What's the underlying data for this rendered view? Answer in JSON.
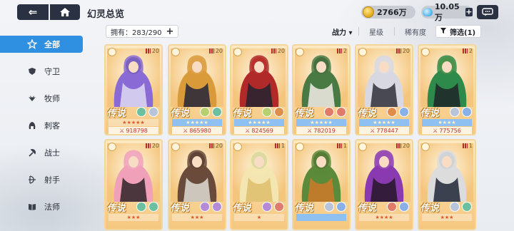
{
  "header": {
    "back_glyph": "⇐",
    "home_icon": "home-icon",
    "title": "幻灵总览",
    "gold": "2766万",
    "gems": "10.05万",
    "plus": "+"
  },
  "sidebar": {
    "items": [
      {
        "label": "全部",
        "icon": "star-icon",
        "active": true
      },
      {
        "label": "守卫",
        "icon": "shield-icon"
      },
      {
        "label": "牧师",
        "icon": "wing-icon"
      },
      {
        "label": "刺客",
        "icon": "hood-icon"
      },
      {
        "label": "战士",
        "icon": "axe-icon"
      },
      {
        "label": "射手",
        "icon": "bow-icon"
      },
      {
        "label": "法师",
        "icon": "book-icon"
      }
    ]
  },
  "filterbar": {
    "owned_label": "拥有：283/290",
    "plus": "+",
    "sort_power": "战力",
    "sort_star": "星级",
    "sort_rarity": "稀有度",
    "filter_label": "筛选(1)"
  },
  "cards": [
    {
      "level": "20",
      "rarity": "传说",
      "power": "918798",
      "stars": "★★★★★",
      "band": "none",
      "faction": [
        "#6cc0a0",
        "#b8c4d8"
      ],
      "palette": [
        "#8a6bd6",
        "#d9d4f2",
        "#303048"
      ]
    },
    {
      "level": "20",
      "rarity": "传说",
      "power": "865980",
      "stars": "★★★★★",
      "band": "blue",
      "faction": [
        "#b8d070",
        "#6cc0a0"
      ],
      "palette": [
        "#d99a3a",
        "#2d2b3a",
        "#f4d6a6"
      ]
    },
    {
      "level": "20",
      "rarity": "传说",
      "power": "824569",
      "stars": "★★★★★",
      "band": "blue",
      "faction": [
        "#b8d070",
        "#e08c4a"
      ],
      "palette": [
        "#b02a2a",
        "#2a2430",
        "#e55a3a"
      ]
    },
    {
      "level": "2",
      "rarity": "传说",
      "power": "782019",
      "stars": "★★★★★",
      "band": "blue",
      "faction": [
        "#e07a6a",
        "#e07a6a"
      ],
      "palette": [
        "#4a7a44",
        "#e9e6de",
        "#2f3a28"
      ]
    },
    {
      "level": "20",
      "rarity": "传说",
      "power": "778447",
      "stars": "★★★★★",
      "band": "blue",
      "faction": [
        "#e08c4a",
        "#8ab0e8"
      ],
      "palette": [
        "#d8d8e2",
        "#3a3a44",
        "#f0e6dc"
      ]
    },
    {
      "level": "2",
      "rarity": "传说",
      "power": "775756",
      "stars": "★★★★",
      "band": "blue",
      "faction": [
        "#b8c4d8",
        "#8ab0e8"
      ],
      "palette": [
        "#2e8a4a",
        "#1f2a2a",
        "#f6c44a"
      ]
    },
    {
      "level": "20",
      "rarity": "传说",
      "power": "",
      "stars": "★★★",
      "band": "none",
      "faction": [
        "#6cc0a0",
        "#6cc0a0"
      ],
      "palette": [
        "#f0a0b8",
        "#3a2a30",
        "#f8e0e8"
      ]
    },
    {
      "level": "20",
      "rarity": "传说",
      "power": "",
      "stars": "★★★",
      "band": "none",
      "faction": [
        "#b58ad6",
        "#b58ad6"
      ],
      "palette": [
        "#6a4a3a",
        "#d8d4cc",
        "#2a2220"
      ]
    },
    {
      "level": "1",
      "rarity": "传说",
      "power": "",
      "stars": "★",
      "band": "none",
      "faction": [
        "#b58ad6",
        "#e07a6a"
      ],
      "palette": [
        "#f4e6b0",
        "#e0c070",
        "#5a8a44"
      ]
    },
    {
      "level": "1",
      "rarity": "传说",
      "power": "",
      "stars": "",
      "band": "blue",
      "faction": [
        "#b8c4d8",
        "#8ab0e8"
      ],
      "palette": [
        "#5a8a3a",
        "#c87a2a",
        "#3a2a1a"
      ]
    },
    {
      "level": "20",
      "rarity": "传说",
      "power": "",
      "stars": "★★★★",
      "band": "none",
      "faction": [
        "#e07a6a",
        "#8ab0e8"
      ],
      "palette": [
        "#8a3ab0",
        "#2a1a30",
        "#f0c0d8"
      ]
    },
    {
      "level": "1",
      "rarity": "传说",
      "power": "",
      "stars": "★★★",
      "band": "none",
      "faction": [
        "#b8c4d8",
        "#6cc0a0"
      ],
      "palette": [
        "#dcdcdc",
        "#2a3040",
        "#8aa0b8"
      ]
    }
  ]
}
